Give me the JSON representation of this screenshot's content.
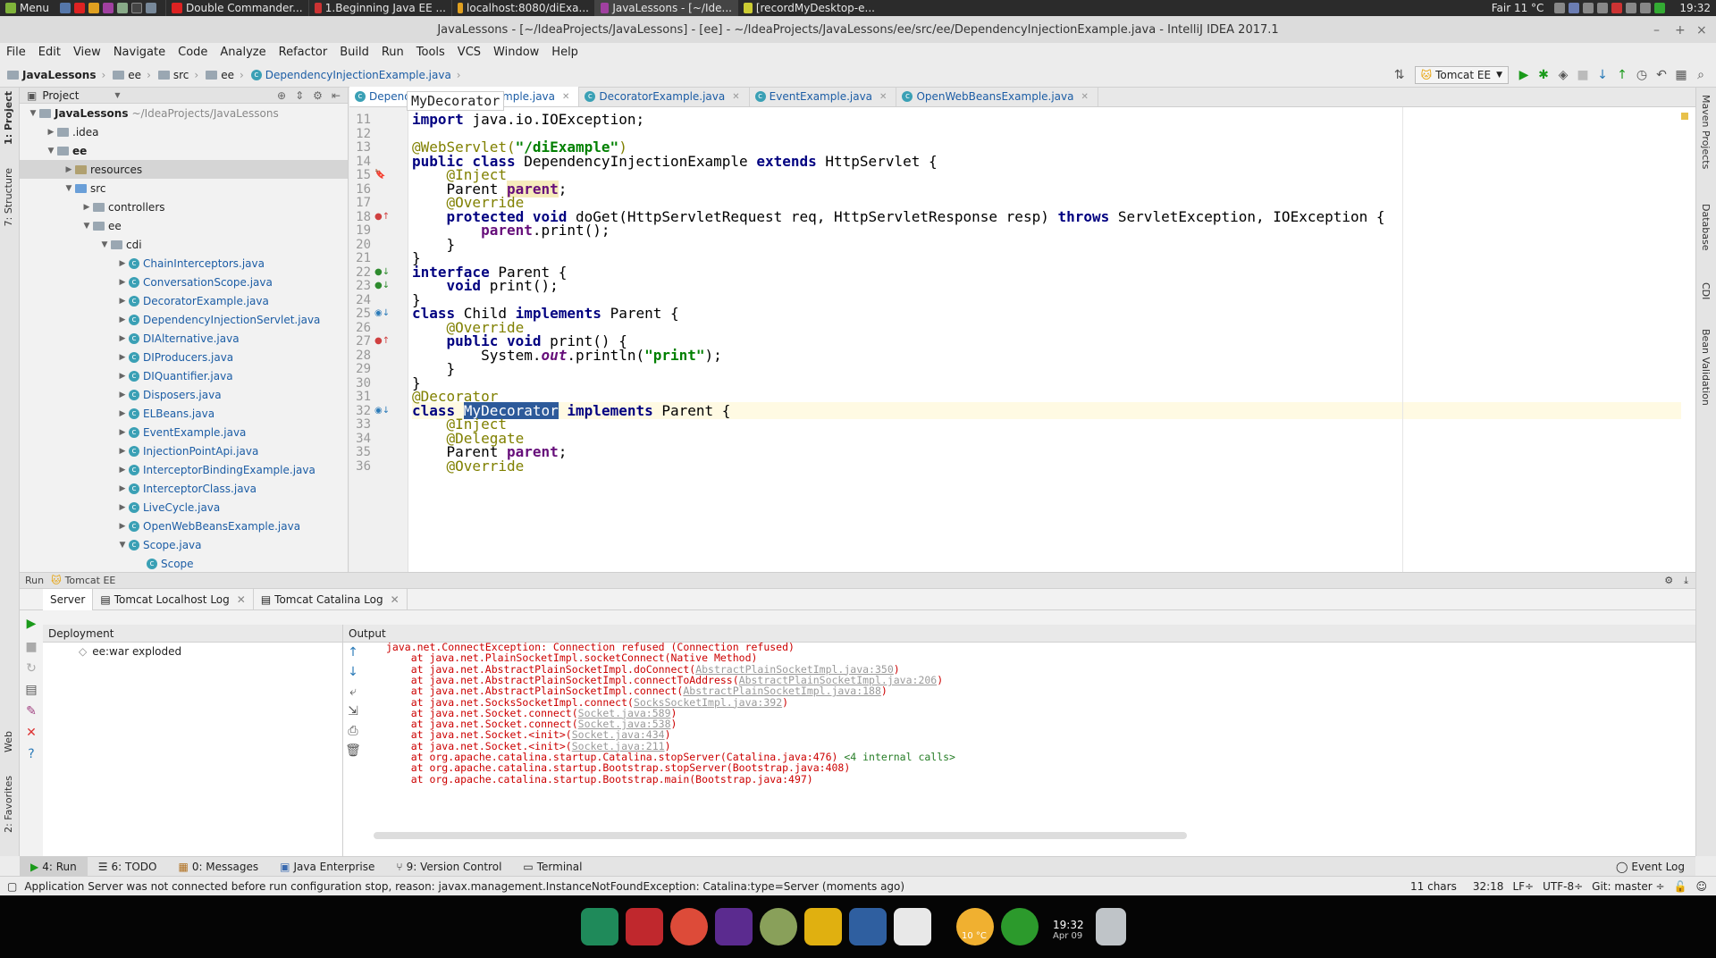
{
  "system_bar": {
    "menu_label": "Menu",
    "tasks": [
      "Double Commander...",
      "1.Beginning Java EE ...",
      "localhost:8080/diExa...",
      "JavaLessons - [~/Ide...",
      "[recordMyDesktop-e..."
    ],
    "weather": "Fair 11 °C",
    "clock": "19:32"
  },
  "window": {
    "title": "JavaLessons - [~/IdeaProjects/JavaLessons] - [ee] - ~/IdeaProjects/JavaLessons/ee/src/ee/DependencyInjectionExample.java - IntelliJ IDEA 2017.1"
  },
  "menubar": [
    "File",
    "Edit",
    "View",
    "Navigate",
    "Code",
    "Analyze",
    "Refactor",
    "Build",
    "Run",
    "Tools",
    "VCS",
    "Window",
    "Help"
  ],
  "navbar": {
    "crumbs": [
      "JavaLessons",
      "ee",
      "src",
      "ee",
      "DependencyInjectionExample.java"
    ],
    "run_config": "Tomcat EE"
  },
  "left_stripe": {
    "project": "1: Project",
    "structure": "7: Structure",
    "web": "Web",
    "favorites": "2: Favorites"
  },
  "right_stripe": [
    "Maven Projects",
    "Database",
    "CDI",
    "Bean Validation"
  ],
  "project_panel": {
    "title": "Project",
    "root_name": "JavaLessons",
    "root_path": "~/IdeaProjects/JavaLessons",
    "rows": [
      {
        "label": ".idea",
        "type": "folder",
        "indent": 1,
        "arrow": "▶"
      },
      {
        "label": "ee",
        "type": "folder",
        "indent": 1,
        "arrow": "▼"
      },
      {
        "label": "resources",
        "type": "folder",
        "indent": 2,
        "arrow": "▶",
        "selected": true
      },
      {
        "label": "src",
        "type": "folder",
        "indent": 2,
        "arrow": "▼"
      },
      {
        "label": "controllers",
        "type": "folder",
        "indent": 3,
        "arrow": "▶"
      },
      {
        "label": "ee",
        "type": "folder",
        "indent": 3,
        "arrow": "▼"
      },
      {
        "label": "cdi",
        "type": "folder",
        "indent": 4,
        "arrow": "▼"
      },
      {
        "label": "ChainInterceptors.java",
        "type": "class",
        "indent": 5,
        "arrow": "▶"
      },
      {
        "label": "ConversationScope.java",
        "type": "class",
        "indent": 5,
        "arrow": "▶"
      },
      {
        "label": "DecoratorExample.java",
        "type": "class",
        "indent": 5,
        "arrow": "▶"
      },
      {
        "label": "DependencyInjectionServlet.java",
        "type": "class",
        "indent": 5,
        "arrow": "▶"
      },
      {
        "label": "DIAlternative.java",
        "type": "class",
        "indent": 5,
        "arrow": "▶"
      },
      {
        "label": "DIProducers.java",
        "type": "class",
        "indent": 5,
        "arrow": "▶"
      },
      {
        "label": "DIQuantifier.java",
        "type": "class",
        "indent": 5,
        "arrow": "▶"
      },
      {
        "label": "Disposers.java",
        "type": "class",
        "indent": 5,
        "arrow": "▶"
      },
      {
        "label": "ELBeans.java",
        "type": "class",
        "indent": 5,
        "arrow": "▶"
      },
      {
        "label": "EventExample.java",
        "type": "class",
        "indent": 5,
        "arrow": "▶"
      },
      {
        "label": "InjectionPointApi.java",
        "type": "class",
        "indent": 5,
        "arrow": "▶"
      },
      {
        "label": "InterceptorBindingExample.java",
        "type": "class",
        "indent": 5,
        "arrow": "▶"
      },
      {
        "label": "InterceptorClass.java",
        "type": "class",
        "indent": 5,
        "arrow": "▶"
      },
      {
        "label": "LiveCycle.java",
        "type": "class",
        "indent": 5,
        "arrow": "▶"
      },
      {
        "label": "OpenWebBeansExample.java",
        "type": "class",
        "indent": 5,
        "arrow": "▶"
      },
      {
        "label": "Scope.java",
        "type": "class",
        "indent": 5,
        "arrow": "▼"
      },
      {
        "label": "Scope",
        "type": "class",
        "indent": 6,
        "arrow": ""
      }
    ]
  },
  "editor": {
    "tabs": [
      {
        "label": "DependencyInjectionExample.java",
        "active": true
      },
      {
        "label": "DecoratorExample.java",
        "active": false
      },
      {
        "label": "EventExample.java",
        "active": false
      },
      {
        "label": "OpenWebBeansExample.java",
        "active": false
      }
    ],
    "popup_label": "MyDecorator",
    "lines": [
      {
        "n": "11",
        "t": [
          [
            "kw",
            "import "
          ],
          [
            "",
            "java.io.IOException;"
          ]
        ]
      },
      {
        "n": "12",
        "t": []
      },
      {
        "n": "13",
        "t": [
          [
            "an",
            "@WebServlet("
          ],
          [
            "str",
            "\"/diExample\""
          ],
          [
            "an",
            ")"
          ]
        ]
      },
      {
        "n": "14",
        "t": [
          [
            "kw",
            "public class "
          ],
          [
            "",
            "DependencyInjectionExample "
          ],
          [
            "kw",
            "extends "
          ],
          [
            "",
            "HttpServlet {"
          ]
        ]
      },
      {
        "n": "15",
        "t": [
          [
            "an",
            "    @Inject"
          ]
        ]
      },
      {
        "n": "16",
        "t": [
          [
            "",
            "    Parent "
          ],
          [
            "fld hl",
            "parent"
          ],
          [
            "",
            ";"
          ]
        ]
      },
      {
        "n": "17",
        "t": [
          [
            "an",
            "    @Override"
          ]
        ]
      },
      {
        "n": "18",
        "t": [
          [
            "kw",
            "    protected void "
          ],
          [
            "",
            "doGet(HttpServletRequest req, HttpServletResponse resp) "
          ],
          [
            "kw",
            "throws "
          ],
          [
            "",
            "ServletException, IOException {"
          ]
        ]
      },
      {
        "n": "19",
        "t": [
          [
            "",
            "        "
          ],
          [
            "fld",
            "parent"
          ],
          [
            "",
            ".print();"
          ]
        ]
      },
      {
        "n": "20",
        "t": [
          [
            "",
            "    }"
          ]
        ]
      },
      {
        "n": "21",
        "t": [
          [
            "",
            "}"
          ]
        ]
      },
      {
        "n": "22",
        "t": [
          [
            "kw",
            "interface "
          ],
          [
            "",
            "Parent {"
          ]
        ]
      },
      {
        "n": "23",
        "t": [
          [
            "kw",
            "    void "
          ],
          [
            "",
            "print();"
          ]
        ]
      },
      {
        "n": "24",
        "t": [
          [
            "",
            "}"
          ]
        ]
      },
      {
        "n": "25",
        "t": [
          [
            "kw",
            "class "
          ],
          [
            "",
            "Child "
          ],
          [
            "kw",
            "implements "
          ],
          [
            "",
            "Parent {"
          ]
        ]
      },
      {
        "n": "26",
        "t": [
          [
            "an",
            "    @Override"
          ]
        ]
      },
      {
        "n": "27",
        "t": [
          [
            "kw",
            "    public void "
          ],
          [
            "",
            "print() {"
          ]
        ]
      },
      {
        "n": "28",
        "t": [
          [
            "",
            "        System."
          ],
          [
            "stat",
            "out"
          ],
          [
            "",
            ".println("
          ],
          [
            "str",
            "\"print\""
          ],
          [
            "",
            ");"
          ]
        ]
      },
      {
        "n": "29",
        "t": [
          [
            "",
            "    }"
          ]
        ]
      },
      {
        "n": "30",
        "t": [
          [
            "",
            "}"
          ]
        ]
      },
      {
        "n": "31",
        "t": [
          [
            "an",
            "@Decorator"
          ]
        ]
      },
      {
        "n": "32",
        "t": [
          [
            "kw",
            "class "
          ],
          [
            "sel",
            "MyDecorator"
          ],
          [
            "",
            " "
          ],
          [
            "kw",
            "implements "
          ],
          [
            "",
            "Parent {"
          ]
        ]
      },
      {
        "n": "33",
        "t": [
          [
            "an",
            "    @Inject"
          ]
        ]
      },
      {
        "n": "34",
        "t": [
          [
            "an",
            "    @Delegate"
          ]
        ]
      },
      {
        "n": "35",
        "t": [
          [
            "",
            "    Parent "
          ],
          [
            "fld",
            "parent"
          ],
          [
            "",
            ";"
          ]
        ]
      },
      {
        "n": "36",
        "t": [
          [
            "an",
            "    @Override"
          ]
        ]
      }
    ]
  },
  "run_panel": {
    "header": "Run",
    "config": "Tomcat EE",
    "tabs": [
      "Server",
      "Tomcat Localhost Log",
      "Tomcat Catalina Log"
    ],
    "deployment_title": "Deployment",
    "deployment_item": "ee:war exploded",
    "output_title": "Output",
    "output_lines": [
      [
        [
          "",
          "java.net.ConnectException: Connection refused (Connection refused)"
        ]
      ],
      [
        [
          "",
          "    at java.net.PlainSocketImpl.socketConnect(Native Method)"
        ]
      ],
      [
        [
          "",
          "    at java.net.AbstractPlainSocketImpl.doConnect("
        ],
        [
          "link",
          "AbstractPlainSocketImpl.java:350"
        ],
        [
          "",
          ")"
        ]
      ],
      [
        [
          "",
          "    at java.net.AbstractPlainSocketImpl.connectToAddress("
        ],
        [
          "link",
          "AbstractPlainSocketImpl.java:206"
        ],
        [
          "",
          ")"
        ]
      ],
      [
        [
          "",
          "    at java.net.AbstractPlainSocketImpl.connect("
        ],
        [
          "link",
          "AbstractPlainSocketImpl.java:188"
        ],
        [
          "",
          ")"
        ]
      ],
      [
        [
          "",
          "    at java.net.SocksSocketImpl.connect("
        ],
        [
          "link",
          "SocksSocketImpl.java:392"
        ],
        [
          "",
          ")"
        ]
      ],
      [
        [
          "",
          "    at java.net.Socket.connect("
        ],
        [
          "link",
          "Socket.java:589"
        ],
        [
          "",
          ")"
        ]
      ],
      [
        [
          "",
          "    at java.net.Socket.connect("
        ],
        [
          "link",
          "Socket.java:538"
        ],
        [
          "",
          ")"
        ]
      ],
      [
        [
          "",
          "    at java.net.Socket.<init>("
        ],
        [
          "link",
          "Socket.java:434"
        ],
        [
          "",
          ")"
        ]
      ],
      [
        [
          "",
          "    at java.net.Socket.<init>("
        ],
        [
          "link",
          "Socket.java:211"
        ],
        [
          "",
          ")"
        ]
      ],
      [
        [
          "",
          "    at org.apache.catalina.startup.Catalina.stopServer(Catalina.java:476) "
        ],
        [
          "intern",
          "<4 internal calls>"
        ]
      ],
      [
        [
          "",
          "    at org.apache.catalina.startup.Bootstrap.stopServer(Bootstrap.java:408)"
        ]
      ],
      [
        [
          "",
          "    at org.apache.catalina.startup.Bootstrap.main(Bootstrap.java:497)"
        ]
      ]
    ]
  },
  "bottom_tabs": [
    "4: Run",
    "6: TODO",
    "0: Messages",
    "Java Enterprise",
    "9: Version Control",
    "Terminal"
  ],
  "event_log": "Event Log",
  "status": {
    "message": "Application Server was not connected before run configuration stop, reason: javax.management.InstanceNotFoundException: Catalina:type=Server (moments ago)",
    "chars": "11 chars",
    "position": "32:18",
    "line_sep": "LF÷",
    "encoding": "UTF-8÷",
    "git": "Git: master ÷"
  },
  "dock": {
    "weather_badge": "10 °C",
    "clock": "19:32",
    "date": "Apr 09"
  },
  "colors": {
    "keyword": "#000080",
    "annotation": "#808000",
    "string": "#008000",
    "field": "#660e7a",
    "selection": "#2d5a9a",
    "error_output": "#cc0000"
  }
}
